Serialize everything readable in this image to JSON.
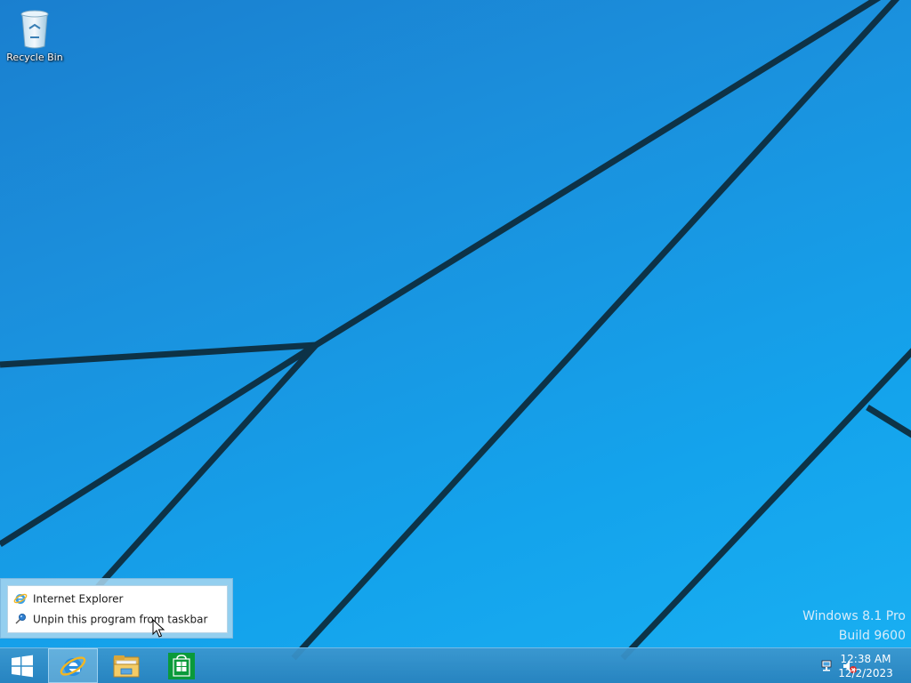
{
  "desktop": {
    "icons": [
      {
        "label": "Recycle Bin",
        "icon": "recycle-bin-icon"
      }
    ],
    "watermark": {
      "edition": "Windows 8.1 Pro",
      "build": "Build 9600"
    }
  },
  "jumplist": {
    "items": [
      {
        "label": "Internet Explorer",
        "icon": "internet-explorer-icon"
      },
      {
        "label": "Unpin this program from taskbar",
        "icon": "unpin-icon"
      }
    ]
  },
  "taskbar": {
    "start": {
      "icon": "windows-logo-icon"
    },
    "pinned": [
      {
        "name": "Internet Explorer",
        "icon": "internet-explorer-icon",
        "active": true
      },
      {
        "name": "File Explorer",
        "icon": "file-explorer-icon",
        "active": false
      },
      {
        "name": "Store",
        "icon": "store-icon",
        "active": false
      }
    ],
    "tray": {
      "icons": [
        "network-icon",
        "volume-muted-icon"
      ],
      "time": "12:38 AM",
      "date": "12/2/2023"
    }
  },
  "colors": {
    "taskbar": "#2f8fcc",
    "wallpaper_top": "#1a7fcf",
    "wallpaper_bottom": "#19b0f2",
    "store_green": "#0a9a3a"
  }
}
